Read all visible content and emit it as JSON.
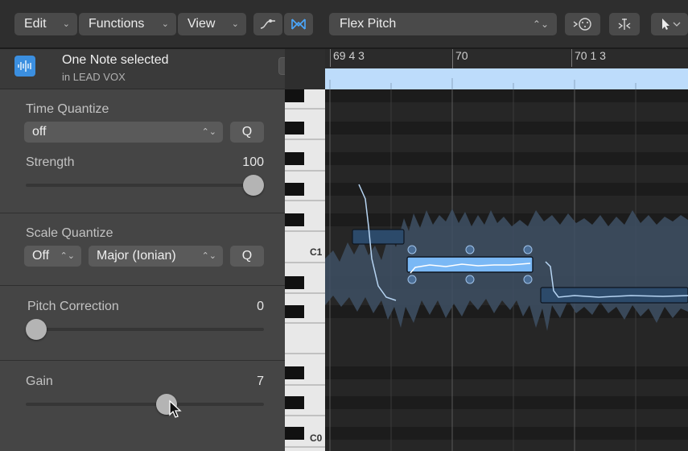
{
  "toolbar": {
    "edit_label": "Edit",
    "functions_label": "Functions",
    "view_label": "View",
    "mode_label": "Flex Pitch"
  },
  "inspector": {
    "selection_title": "One Note selected",
    "selection_subtitle": "in LEAD VOX",
    "time_quantize": {
      "label": "Time Quantize",
      "value": "off",
      "q_label": "Q",
      "strength_label": "Strength",
      "strength_value": "100",
      "strength_fraction": 1.0
    },
    "scale_quantize": {
      "label": "Scale Quantize",
      "mode_value": "Off",
      "scale_value": "Major (Ionian)",
      "q_label": "Q"
    },
    "pitch_correction": {
      "label": "Pitch Correction",
      "value": "0",
      "fraction": 0.0
    },
    "gain": {
      "label": "Gain",
      "value": "7",
      "fraction": 0.6
    }
  },
  "keyboard": {
    "labels": [
      "C1",
      "C0"
    ]
  },
  "ruler": {
    "bars": [
      "69 4 3",
      "70",
      "70 1 3"
    ]
  },
  "colors": {
    "accent": "#3b8fe0",
    "region": "#bddcfb",
    "selected_note": "#7ab8f5",
    "note": "#2e4a6a"
  }
}
